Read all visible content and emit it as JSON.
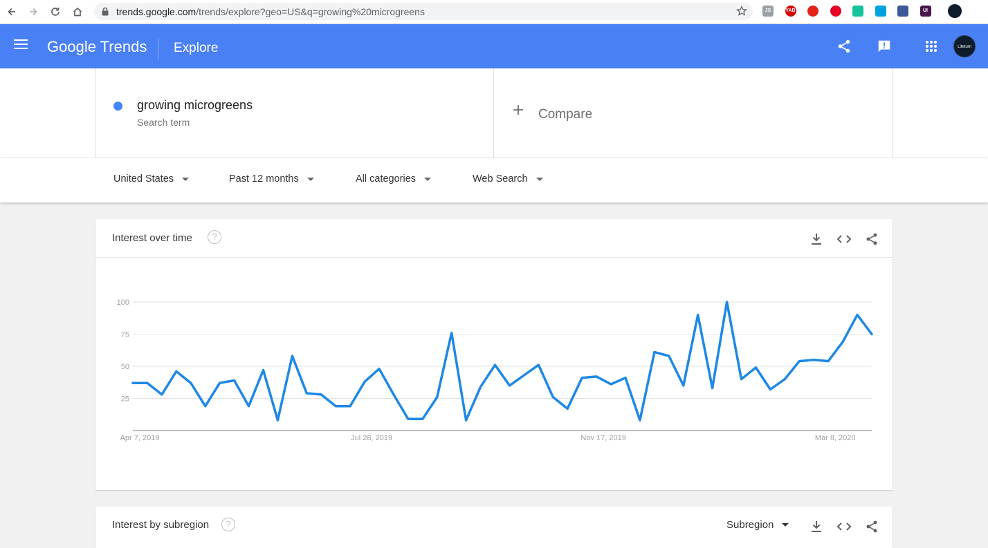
{
  "browser": {
    "url_host": "trends.google.com",
    "url_rest": "/trends/explore?geo=US&q=growing%20microgreens",
    "icons": [
      "back-icon",
      "forward-icon",
      "reload-icon",
      "home-icon",
      "lock-icon",
      "star-icon"
    ],
    "extensions": [
      {
        "name": "extension-js-icon",
        "color": "#9aa0a6",
        "label": "JS"
      },
      {
        "name": "extension-yab-icon",
        "color": "#d50000",
        "label": "YAB"
      },
      {
        "name": "extension-adblock-icon",
        "color": "#e62117",
        "label": ""
      },
      {
        "name": "extension-pinterest-icon",
        "color": "#e60023",
        "label": ""
      },
      {
        "name": "extension-grammarly-icon",
        "color": "#15c39a",
        "label": ""
      },
      {
        "name": "extension-wave-icon",
        "color": "#00a3e0",
        "label": ""
      },
      {
        "name": "extension-buffer-icon",
        "color": "#3b5998",
        "label": ""
      },
      {
        "name": "extension-ui-icon",
        "color": "#4a154b",
        "label": "UI"
      }
    ]
  },
  "header": {
    "logo_google": "Google",
    "logo_trends": "Trends",
    "page_title": "Explore",
    "avatar_text": "Litetum",
    "background": "#4a80f5"
  },
  "search_term": {
    "name": "growing microgreens",
    "subtitle": "Search term",
    "color": "#4285f4"
  },
  "compare": {
    "label": "Compare"
  },
  "filters": [
    {
      "label": "United States"
    },
    {
      "label": "Past 12 months"
    },
    {
      "label": "All categories"
    },
    {
      "label": "Web Search"
    }
  ],
  "interest_over_time": {
    "title": "Interest over time",
    "help": "?"
  },
  "interest_by_subregion": {
    "title": "Interest by subregion",
    "help": "?",
    "select_label": "Subregion"
  },
  "chart_data": {
    "type": "line",
    "title": "Interest over time",
    "y_ticks": [
      "100",
      "75",
      "50",
      "25"
    ],
    "ylim": [
      0,
      100
    ],
    "x_tick_labels": [
      "Apr 7, 2019",
      "Jul 28, 2019",
      "Nov 17, 2019",
      "Mar 8, 2020"
    ],
    "x_tick_indices": [
      0,
      16,
      32,
      48
    ],
    "grid": true,
    "series": [
      {
        "color": "#1e88e5",
        "values": [
          37,
          37,
          28,
          46,
          37,
          19,
          37,
          39,
          19,
          47,
          8,
          58,
          29,
          28,
          19,
          19,
          38,
          48,
          28,
          9,
          9,
          26,
          76,
          8,
          34,
          51,
          35,
          43,
          51,
          26,
          17,
          41,
          42,
          36,
          41,
          8,
          61,
          58,
          35,
          90,
          33,
          100,
          40,
          49,
          32,
          40,
          54,
          55,
          54,
          69,
          90,
          75
        ]
      }
    ]
  }
}
